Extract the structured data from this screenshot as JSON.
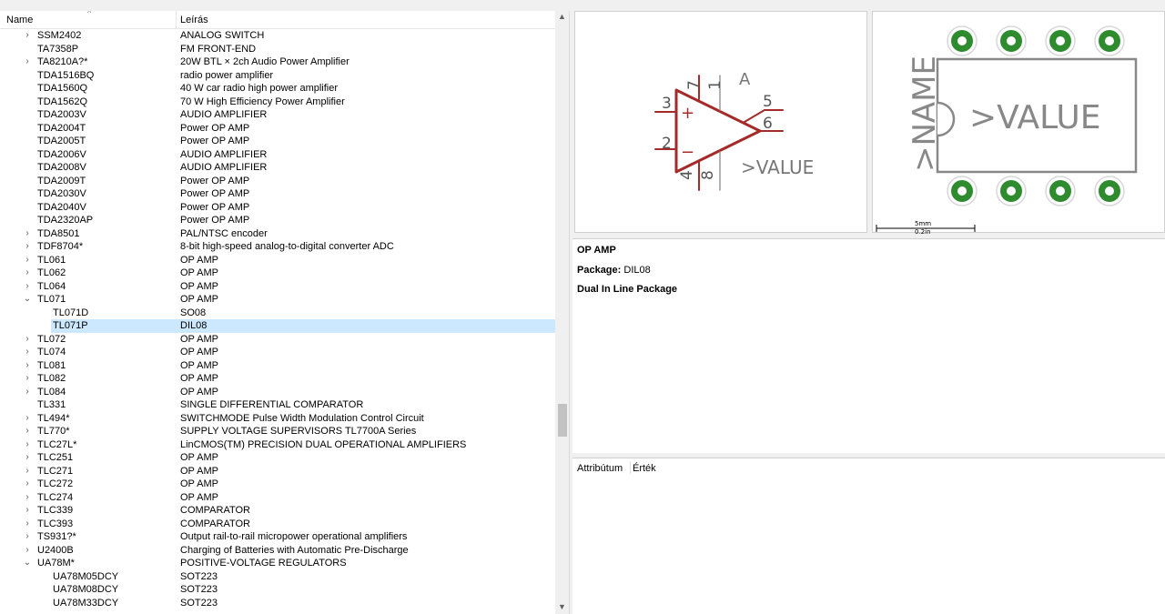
{
  "tree": {
    "header": {
      "name": "Name",
      "description": "Leírás"
    },
    "rows": [
      {
        "name": "SSM2402",
        "desc": "ANALOG SWITCH",
        "level": 0,
        "exp": "›"
      },
      {
        "name": "TA7358P",
        "desc": "FM FRONT-END",
        "level": 0,
        "exp": ""
      },
      {
        "name": "TA8210A?*",
        "desc": "20W BTL × 2ch Audio Power Amplifier",
        "level": 0,
        "exp": "›"
      },
      {
        "name": "TDA1516BQ",
        "desc": "radio power amplifier",
        "level": 0,
        "exp": ""
      },
      {
        "name": "TDA1560Q",
        "desc": "40 W car radio high power amplifier",
        "level": 0,
        "exp": ""
      },
      {
        "name": "TDA1562Q",
        "desc": "70 W High Efficiency Power Amplifier",
        "level": 0,
        "exp": ""
      },
      {
        "name": "TDA2003V",
        "desc": "AUDIO AMPLIFIER",
        "level": 0,
        "exp": ""
      },
      {
        "name": "TDA2004T",
        "desc": "Power OP AMP",
        "level": 0,
        "exp": ""
      },
      {
        "name": "TDA2005T",
        "desc": "Power OP AMP",
        "level": 0,
        "exp": ""
      },
      {
        "name": "TDA2006V",
        "desc": "AUDIO AMPLIFIER",
        "level": 0,
        "exp": ""
      },
      {
        "name": "TDA2008V",
        "desc": "AUDIO AMPLIFIER",
        "level": 0,
        "exp": ""
      },
      {
        "name": "TDA2009T",
        "desc": "Power OP AMP",
        "level": 0,
        "exp": ""
      },
      {
        "name": "TDA2030V",
        "desc": "Power OP AMP",
        "level": 0,
        "exp": ""
      },
      {
        "name": "TDA2040V",
        "desc": "Power OP AMP",
        "level": 0,
        "exp": ""
      },
      {
        "name": "TDA2320AP",
        "desc": "Power OP AMP",
        "level": 0,
        "exp": ""
      },
      {
        "name": "TDA8501",
        "desc": "PAL/NTSC encoder",
        "level": 0,
        "exp": "›"
      },
      {
        "name": "TDF8704*",
        "desc": "8-bit high-speed analog-to-digital converter ADC",
        "level": 0,
        "exp": "›"
      },
      {
        "name": "TL061",
        "desc": "OP AMP",
        "level": 0,
        "exp": "›"
      },
      {
        "name": "TL062",
        "desc": "OP AMP",
        "level": 0,
        "exp": "›"
      },
      {
        "name": "TL064",
        "desc": "OP AMP",
        "level": 0,
        "exp": "›"
      },
      {
        "name": "TL071",
        "desc": "OP AMP",
        "level": 0,
        "exp": "⌄"
      },
      {
        "name": "TL071D",
        "desc": "SO08",
        "level": 1,
        "exp": ""
      },
      {
        "name": "TL071P",
        "desc": "DIL08",
        "level": 1,
        "exp": "",
        "selected": true
      },
      {
        "name": "TL072",
        "desc": "OP AMP",
        "level": 0,
        "exp": "›"
      },
      {
        "name": "TL074",
        "desc": "OP AMP",
        "level": 0,
        "exp": "›"
      },
      {
        "name": "TL081",
        "desc": "OP AMP",
        "level": 0,
        "exp": "›"
      },
      {
        "name": "TL082",
        "desc": "OP AMP",
        "level": 0,
        "exp": "›"
      },
      {
        "name": "TL084",
        "desc": "OP AMP",
        "level": 0,
        "exp": "›"
      },
      {
        "name": "TL331",
        "desc": "SINGLE DIFFERENTIAL COMPARATOR",
        "level": 0,
        "exp": ""
      },
      {
        "name": "TL494*",
        "desc": "SWITCHMODE Pulse Width Modulation Control Circuit",
        "level": 0,
        "exp": "›"
      },
      {
        "name": "TL770*",
        "desc": "SUPPLY VOLTAGE SUPERVISORS TL7700A Series",
        "level": 0,
        "exp": "›"
      },
      {
        "name": "TLC27L*",
        "desc": "LinCMOS(TM) PRECISION DUAL OPERATIONAL AMPLIFIERS",
        "level": 0,
        "exp": "›"
      },
      {
        "name": "TLC251",
        "desc": "OP AMP",
        "level": 0,
        "exp": "›"
      },
      {
        "name": "TLC271",
        "desc": "OP AMP",
        "level": 0,
        "exp": "›"
      },
      {
        "name": "TLC272",
        "desc": "OP AMP",
        "level": 0,
        "exp": "›"
      },
      {
        "name": "TLC274",
        "desc": "OP AMP",
        "level": 0,
        "exp": "›"
      },
      {
        "name": "TLC339",
        "desc": "COMPARATOR",
        "level": 0,
        "exp": "›"
      },
      {
        "name": "TLC393",
        "desc": "COMPARATOR",
        "level": 0,
        "exp": "›"
      },
      {
        "name": "TS931?*",
        "desc": "Output rail-to-rail micropower operational amplifiers",
        "level": 0,
        "exp": "›"
      },
      {
        "name": "U2400B",
        "desc": "Charging of Batteries with Automatic Pre-Discharge",
        "level": 0,
        "exp": "›"
      },
      {
        "name": "UA78M*",
        "desc": "POSITIVE-VOLTAGE REGULATORS",
        "level": 0,
        "exp": "⌄"
      },
      {
        "name": "UA78M05DCY",
        "desc": "SOT223",
        "level": 1,
        "exp": ""
      },
      {
        "name": "UA78M08DCY",
        "desc": "SOT223",
        "level": 1,
        "exp": ""
      },
      {
        "name": "UA78M33DCY",
        "desc": "SOT223",
        "level": 1,
        "exp": ""
      }
    ]
  },
  "symbol": {
    "gate": "A",
    "value": ">VALUE",
    "pins": {
      "in_plus": "3",
      "in_minus": "2",
      "out": "6",
      "pin5": "5",
      "pin7": "7",
      "pin1": "1",
      "pin4": "4",
      "pin8": "8"
    },
    "plus": "+",
    "minus": "−",
    "color": "#a52a2a"
  },
  "package": {
    "name": ">NAME",
    "value": ">VALUE",
    "scale_metric": "5mm",
    "scale_imperial": "0,2in",
    "pad_color": "#2e8b2e"
  },
  "info": {
    "title": "OP AMP",
    "package_label": "Package:",
    "package_value": "DIL08",
    "package_desc": "Dual In Line Package"
  },
  "attributes": {
    "col_attr": "Attribútum",
    "col_value": "Érték"
  }
}
